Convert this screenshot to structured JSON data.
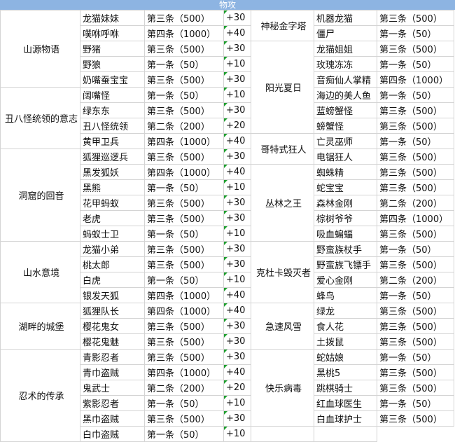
{
  "header": {
    "title": "物攻"
  },
  "groups_left": [
    {
      "name": "山源物语"
    },
    {
      "name": "丑八怪统领的意志"
    },
    {
      "name": "洞窟的回音"
    },
    {
      "name": "山水意境"
    },
    {
      "name": "湖畔的城堡"
    },
    {
      "name": "忍术的传承"
    }
  ],
  "rows_left": [
    {
      "name": "龙猫妹妹",
      "cond": "第三条（500）",
      "bonus": "+30"
    },
    {
      "name": "噗咻呼咻",
      "cond": "第四条（1000）",
      "bonus": "+40"
    },
    {
      "name": "野猪",
      "cond": "第三条（500）",
      "bonus": "+30"
    },
    {
      "name": "野狼",
      "cond": "第一条（50）",
      "bonus": "+10"
    },
    {
      "name": "奶嘴蚕宝宝",
      "cond": "第三条（500）",
      "bonus": "+30"
    },
    {
      "name": "阔嘴怪",
      "cond": "第一条（50）",
      "bonus": "+10"
    },
    {
      "name": "绿东东",
      "cond": "第三条（500）",
      "bonus": "+30"
    },
    {
      "name": "丑八怪统领",
      "cond": "第二条（200）",
      "bonus": "+20"
    },
    {
      "name": "黄甲卫兵",
      "cond": "第四条（1000）",
      "bonus": "+40"
    },
    {
      "name": "狐狸巡逻兵",
      "cond": "第三条（500）",
      "bonus": "+30"
    },
    {
      "name": "黑发狐妖",
      "cond": "第四条（1000）",
      "bonus": "+40"
    },
    {
      "name": "黑熊",
      "cond": "第一条（50）",
      "bonus": "+10"
    },
    {
      "name": "花甲蚂蚁",
      "cond": "第三条（500）",
      "bonus": "+30"
    },
    {
      "name": "老虎",
      "cond": "第三条（500）",
      "bonus": "+30"
    },
    {
      "name": "蚂蚁士卫",
      "cond": "第一条（50）",
      "bonus": "+10"
    },
    {
      "name": "龙猫小弟",
      "cond": "第三条（500）",
      "bonus": "+30"
    },
    {
      "name": "桃太郎",
      "cond": "第三条（500）",
      "bonus": "+30"
    },
    {
      "name": "白虎",
      "cond": "第一条（50）",
      "bonus": "+10"
    },
    {
      "name": "银发天狐",
      "cond": "第四条（1000）",
      "bonus": "+40"
    },
    {
      "name": "狐狸队长",
      "cond": "第四条（1000）",
      "bonus": "+40"
    },
    {
      "name": "樱花鬼女",
      "cond": "第三条（500）",
      "bonus": "+30"
    },
    {
      "name": "樱花鬼魅",
      "cond": "第三条（500）",
      "bonus": "+30"
    },
    {
      "name": "青影忍者",
      "cond": "第三条（500）",
      "bonus": "+30"
    },
    {
      "name": "青巾盗贼",
      "cond": "第四条（1000）",
      "bonus": "+40"
    },
    {
      "name": "鬼武士",
      "cond": "第二条（200）",
      "bonus": "+20"
    },
    {
      "name": "紫影忍者",
      "cond": "第一条（50）",
      "bonus": "+10"
    },
    {
      "name": "黑巾盗贼",
      "cond": "第三条（500）",
      "bonus": "+30"
    },
    {
      "name": "白巾盗贼",
      "cond": "第一条（50）",
      "bonus": "+10"
    }
  ],
  "groups_right": [
    {
      "name": "神秘金字塔"
    },
    {
      "name": "阳光夏日"
    },
    {
      "name": "哥特式狂人"
    },
    {
      "name": "丛林之王"
    },
    {
      "name": "克杜卡毁灭者"
    },
    {
      "name": "急速风雪"
    },
    {
      "name": "快乐病毒"
    }
  ],
  "rows_right": [
    {
      "name": "机器龙猫",
      "cond": "第三条（500）"
    },
    {
      "name": "僵尸",
      "cond": "第一条（50）"
    },
    {
      "name": "龙猫姐姐",
      "cond": "第三条（500）"
    },
    {
      "name": "玫瑰冻冻",
      "cond": "第一条（50）"
    },
    {
      "name": "音痴仙人掌精",
      "cond": "第四条（1000）"
    },
    {
      "name": "海边的美人鱼",
      "cond": "第一条（50）"
    },
    {
      "name": "蓝螃蟹怪",
      "cond": "第三条（500）"
    },
    {
      "name": "螃蟹怪",
      "cond": "第三条（500）"
    },
    {
      "name": "亡灵巫师",
      "cond": "第一条（50）"
    },
    {
      "name": "电锯狂人",
      "cond": "第三条（500）"
    },
    {
      "name": "蜘蛛精",
      "cond": "第三条（500）"
    },
    {
      "name": "蛇宝宝",
      "cond": "第三条（500）"
    },
    {
      "name": "森林金刚",
      "cond": "第二条（200）"
    },
    {
      "name": "棕树爷爷",
      "cond": "第四条（1000）"
    },
    {
      "name": "吸血蝙蝠",
      "cond": "第三条（500）"
    },
    {
      "name": "野蛮族杖手",
      "cond": "第一条（50）"
    },
    {
      "name": "野蛮族飞镖手",
      "cond": "第三条（500）"
    },
    {
      "name": "爱心金刚",
      "cond": "第二条（200）"
    },
    {
      "name": "蜂鸟",
      "cond": "第一条（50）"
    },
    {
      "name": "绿龙",
      "cond": "第三条（500）"
    },
    {
      "name": "食人花",
      "cond": "第三条（500）"
    },
    {
      "name": "土拨鼠",
      "cond": "第三条（500）"
    },
    {
      "name": "蛇姑娘",
      "cond": "第一条（50）"
    },
    {
      "name": "黑桃5",
      "cond": "第三条（500）"
    },
    {
      "name": "跳棋骑士",
      "cond": "第三条（500）"
    },
    {
      "name": "红血球医生",
      "cond": "第一条（50）"
    },
    {
      "name": "白血球护士",
      "cond": "第三条（500）"
    }
  ]
}
